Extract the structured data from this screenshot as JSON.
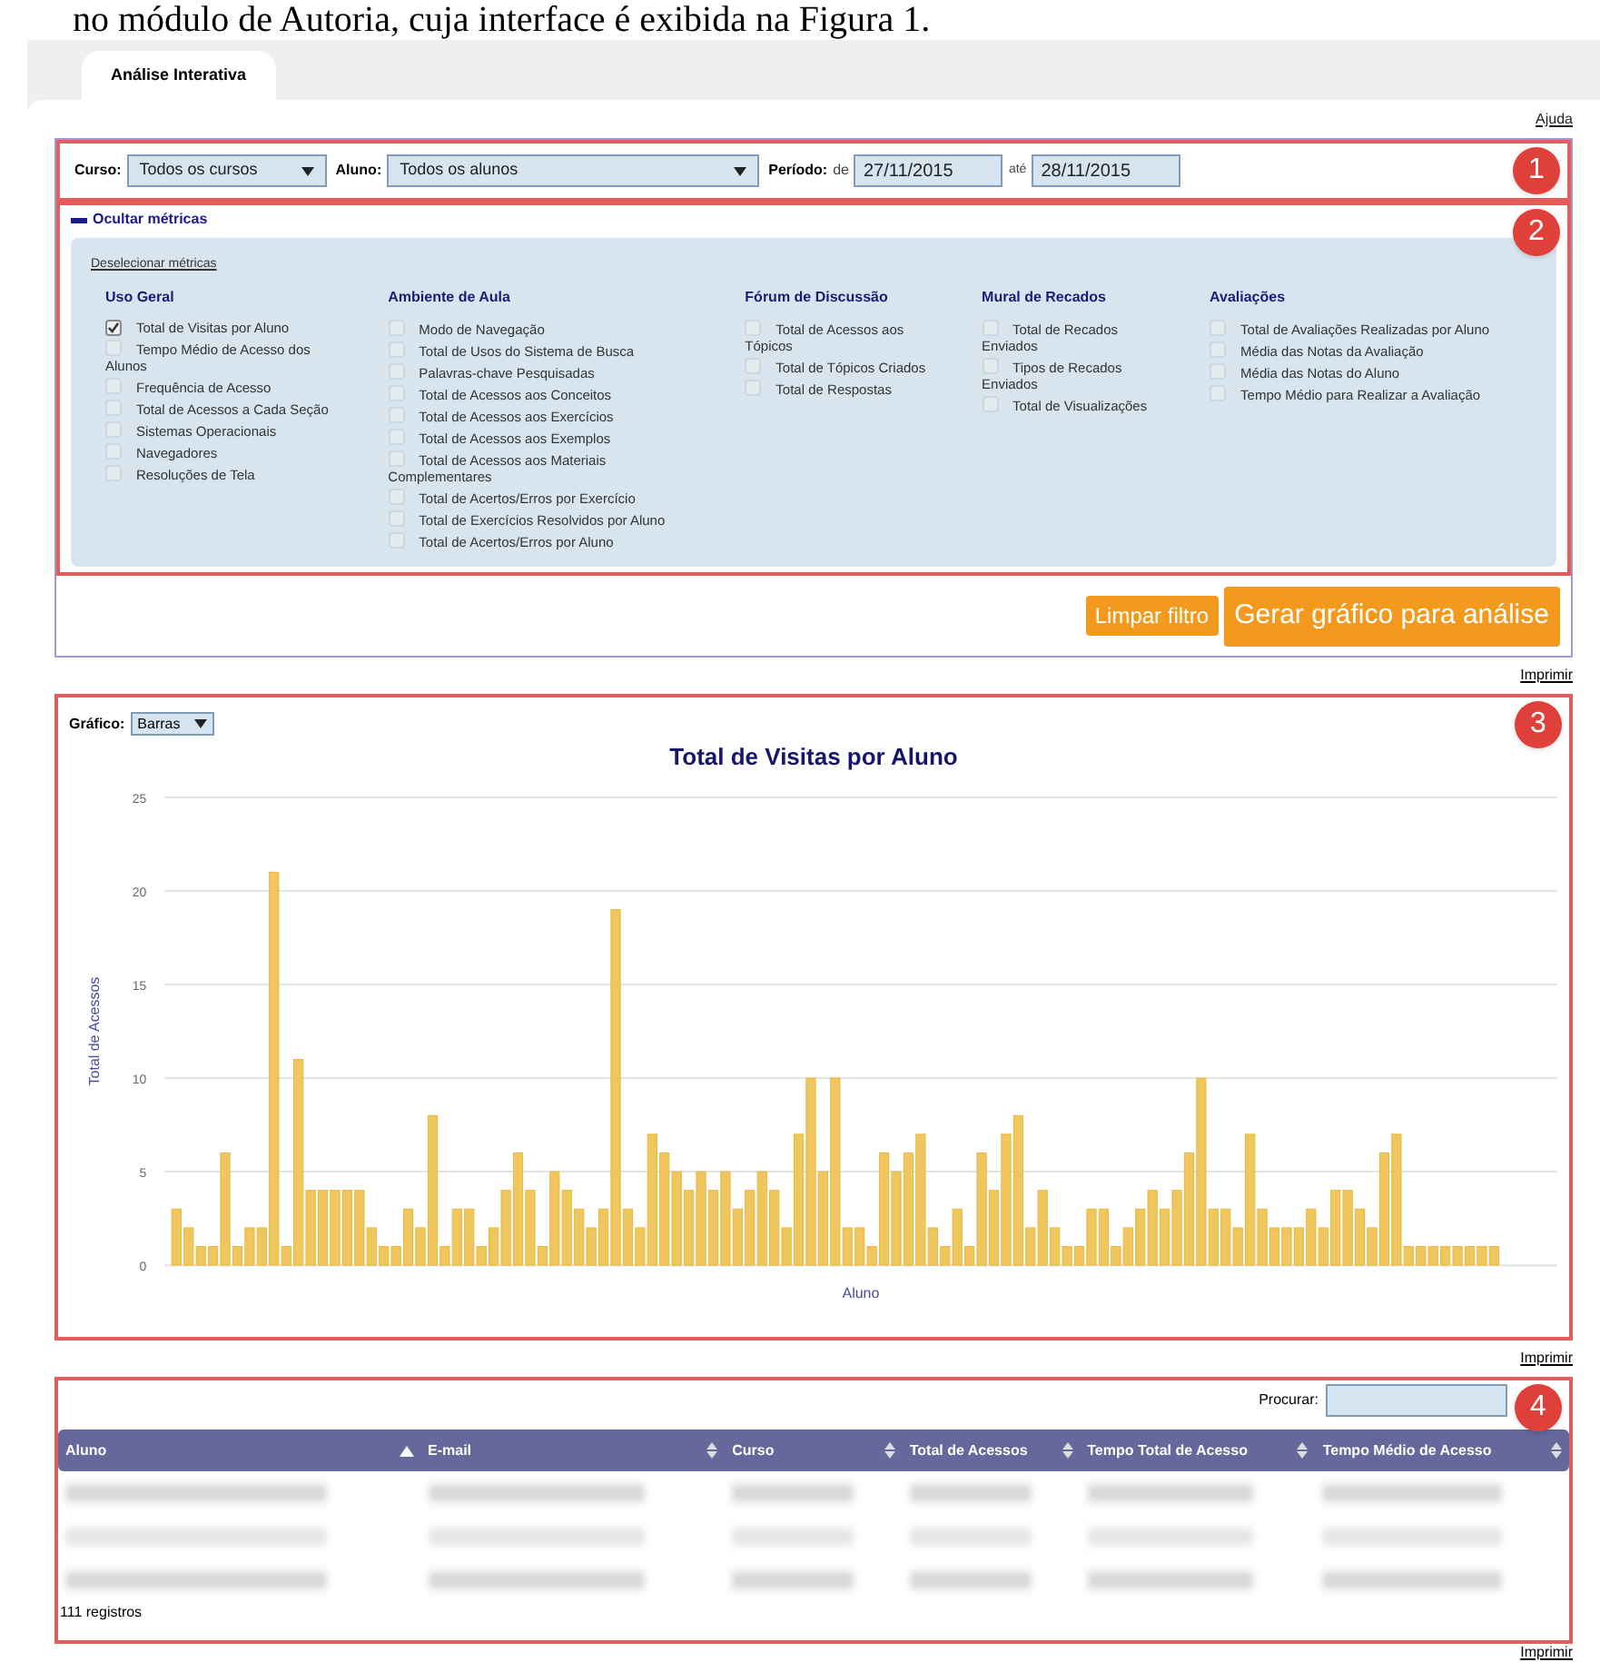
{
  "caption": "no módulo de Autoria, cuja interface é exibida na Figura 1.",
  "tab": {
    "label": "Análise Interativa",
    "selected": true
  },
  "help_link": "Ajuda",
  "filters": {
    "callout": "1",
    "course": {
      "label": "Curso:",
      "value": "Todos os cursos"
    },
    "student": {
      "label": "Aluno:",
      "value": "Todos os alunos"
    },
    "period": {
      "label": "Período:",
      "from_label": "de",
      "from": "27/11/2015",
      "to_label": "até",
      "to": "28/11/2015"
    }
  },
  "metrics": {
    "callout": "2",
    "toggle": "Ocultar métricas",
    "expanded": true,
    "deselect_link": "Deselecionar métricas",
    "groups": [
      {
        "title": "Uso Geral",
        "items": [
          {
            "label": "Total de Visitas por Aluno",
            "checked": true
          },
          {
            "label": "Tempo Médio de Acesso dos Alunos",
            "checked": false
          },
          {
            "label": "Frequência de Acesso",
            "checked": false
          },
          {
            "label": "Total de Acessos a Cada Seção",
            "checked": false
          },
          {
            "label": "Sistemas Operacionais",
            "checked": false
          },
          {
            "label": "Navegadores",
            "checked": false
          },
          {
            "label": "Resoluções de Tela",
            "checked": false
          }
        ]
      },
      {
        "title": "Ambiente de Aula",
        "items": [
          {
            "label": "Modo de Navegação",
            "checked": false
          },
          {
            "label": "Total de Usos do Sistema de Busca",
            "checked": false
          },
          {
            "label": "Palavras-chave Pesquisadas",
            "checked": false
          },
          {
            "label": "Total de Acessos aos Conceitos",
            "checked": false
          },
          {
            "label": "Total de Acessos aos Exercícios",
            "checked": false
          },
          {
            "label": "Total de Acessos aos Exemplos",
            "checked": false
          },
          {
            "label": "Total de Acessos aos Materiais Complementares",
            "checked": false
          },
          {
            "label": "Total de Acertos/Erros por Exercício",
            "checked": false
          },
          {
            "label": "Total de Exercícios Resolvidos por Aluno",
            "checked": false
          },
          {
            "label": "Total de Acertos/Erros por Aluno",
            "checked": false
          }
        ]
      },
      {
        "title": "Fórum de Discussão",
        "items": [
          {
            "label": "Total de Acessos aos Tópicos",
            "checked": false
          },
          {
            "label": "Total de Tópicos Criados",
            "checked": false
          },
          {
            "label": "Total de Respostas",
            "checked": false
          }
        ]
      },
      {
        "title": "Mural de Recados",
        "items": [
          {
            "label": "Total de Recados Enviados",
            "checked": false
          },
          {
            "label": "Tipos de Recados Enviados",
            "checked": false
          },
          {
            "label": "Total de Visualizações",
            "checked": false
          }
        ]
      },
      {
        "title": "Avaliações",
        "items": [
          {
            "label": "Total de Avaliações Realizadas por Aluno",
            "checked": false
          },
          {
            "label": "Média das Notas da Avaliação",
            "checked": false
          },
          {
            "label": "Média das Notas do Aluno",
            "checked": false
          },
          {
            "label": "Tempo Médio para Realizar a Avaliação",
            "checked": false
          }
        ]
      }
    ]
  },
  "buttons": [
    "Limpar filtro",
    "Gerar gráfico para análise"
  ],
  "print_link_1": "Imprimir",
  "chart_panel": {
    "callout": "3",
    "type_label": "Gráfico:",
    "type_value": "Barras",
    "chart_data": {
      "type": "bar",
      "title": "Total de Visitas por Aluno",
      "xlabel": "Aluno",
      "ylabel": "Total de Acessos",
      "ylim": [
        0,
        25
      ],
      "yticks": [
        0,
        5,
        10,
        15,
        20,
        25
      ],
      "grid": true,
      "series": [
        {
          "color": "#f0c75e",
          "values": [
            3,
            2,
            1,
            1,
            6,
            1,
            2,
            2,
            21,
            1,
            11,
            4,
            4,
            4,
            4,
            4,
            2,
            1,
            1,
            3,
            2,
            8,
            1,
            3,
            3,
            1,
            2,
            4,
            6,
            4,
            1,
            5,
            4,
            3,
            2,
            3,
            19,
            3,
            2,
            7,
            6,
            5,
            4,
            5,
            4,
            5,
            3,
            4,
            5,
            4,
            2,
            7,
            10,
            5,
            10,
            2,
            2,
            1,
            6,
            5,
            6,
            7,
            2,
            1,
            3,
            1,
            6,
            4,
            7,
            8,
            2,
            4,
            2,
            1,
            1,
            3,
            3,
            1,
            2,
            3,
            4,
            3,
            4,
            6,
            10,
            3,
            3,
            2,
            7,
            3,
            2,
            2,
            2,
            3,
            2,
            4,
            4,
            3,
            2,
            6,
            7,
            1,
            1,
            1,
            1,
            1,
            1,
            1,
            1
          ]
        }
      ]
    }
  },
  "print_link_2": "Imprimir",
  "table": {
    "callout": "4",
    "search_label": "Procurar:",
    "columns": [
      {
        "label": "Aluno",
        "sorted": true
      },
      {
        "label": "E-mail",
        "sorted": false
      },
      {
        "label": "Curso",
        "sorted": false
      },
      {
        "label": "Total de Acessos",
        "sorted": false
      },
      {
        "label": "Tempo Total de Acesso",
        "sorted": false
      },
      {
        "label": "Tempo Médio de Acesso",
        "sorted": false
      }
    ],
    "footer": "111 registros",
    "print_link": "Imprimir"
  }
}
